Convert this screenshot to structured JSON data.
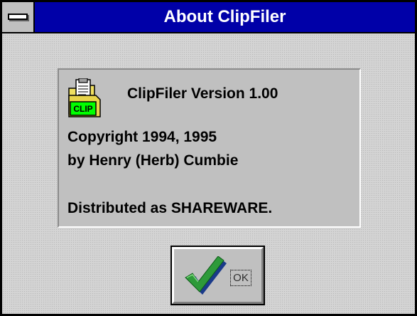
{
  "window": {
    "title": "About ClipFiler"
  },
  "panel": {
    "app_icon": "clipfiler-clip-folder-icon",
    "icon_label": "CLIP",
    "version_line": "ClipFiler Version 1.00",
    "copyright_line": "Copyright 1994, 1995",
    "author_line": "by Henry (Herb) Cumbie",
    "distribution_line": "Distributed as SHAREWARE."
  },
  "ok_button": {
    "label": "OK",
    "icon": "checkmark-icon"
  },
  "colors": {
    "titlebar": "#0000a8",
    "title_text": "#ffffff",
    "window_bg": "#d4d4d4",
    "panel_bg": "#c0c0c0",
    "checkmark": "#2e9a3a",
    "clip_badge": "#00ff00"
  }
}
